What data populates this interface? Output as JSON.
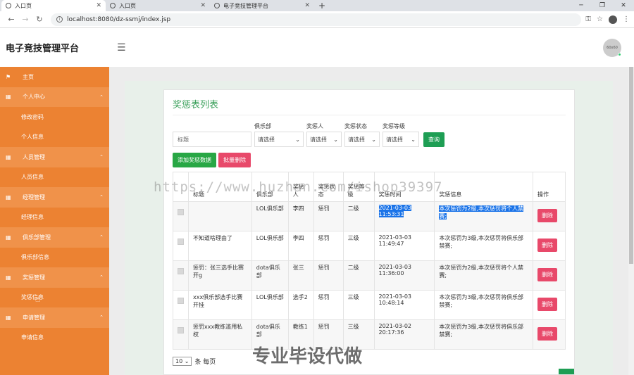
{
  "browser": {
    "tabs": [
      {
        "label": "入口页",
        "active": true
      },
      {
        "label": "入口页",
        "active": false
      },
      {
        "label": "电子竞技管理平台",
        "active": false
      }
    ],
    "url": "localhost:8080/dz-ssmj/index.jsp"
  },
  "app": {
    "title": "电子竞技管理平台",
    "avatar_text": "60x60"
  },
  "sidebar": {
    "home": "主页",
    "groups": [
      {
        "label": "个人中心",
        "items": [
          "修改密码",
          "个人信息"
        ]
      },
      {
        "label": "人员管理",
        "items": [
          "人员信息"
        ]
      },
      {
        "label": "经理管理",
        "items": [
          "经理信息"
        ]
      },
      {
        "label": "俱乐部管理",
        "items": [
          "俱乐部信息"
        ]
      },
      {
        "label": "奖惩管理",
        "items": [
          "奖惩信息"
        ]
      },
      {
        "label": "申请管理",
        "items": [
          "申请信息"
        ]
      }
    ]
  },
  "page": {
    "title": "奖惩表列表",
    "filters": {
      "title_placeholder": "标题",
      "club_label": "俱乐部",
      "club_value": "请选择",
      "person_label": "奖惩人",
      "person_value": "请选择",
      "status_label": "奖惩状态",
      "status_value": "请选择",
      "level_label": "奖惩等级",
      "level_value": "请选择",
      "search_button": "查询"
    },
    "add_button": "添加奖惩数据",
    "batch_delete_button": "批量删除",
    "table": {
      "headers": [
        "",
        "标题",
        "俱乐部",
        "奖惩人",
        "奖惩状态",
        "奖惩等级",
        "奖惩时间",
        "奖惩信息",
        "操作"
      ],
      "rows": [
        {
          "title": "",
          "club": "LOL俱乐部",
          "person": "李四",
          "status": "惩罚",
          "level": "二级",
          "time": "2021-03-03 11:53:31",
          "info": "本次惩罚为2级,本次惩罚将个人禁赛;",
          "delete": "删除"
        },
        {
          "title": "不知道啥理由了",
          "club": "LOL俱乐部",
          "person": "李四",
          "status": "惩罚",
          "level": "三级",
          "time": "2021-03-03 11:49:47",
          "info": "本次惩罚为3级,本次惩罚将俱乐部禁赛;",
          "delete": "删除"
        },
        {
          "title": "惩罚：张三选手比赛开g",
          "club": "dota俱乐部",
          "person": "张三",
          "status": "惩罚",
          "level": "二级",
          "time": "2021-03-03 11:36:00",
          "info": "本次惩罚为2级,本次惩罚将个人禁赛;",
          "delete": "删除"
        },
        {
          "title": "xxx俱乐部选手比赛开挂",
          "club": "LOL俱乐部",
          "person": "选手2",
          "status": "惩罚",
          "level": "三级",
          "time": "2021-03-03 10:48:14",
          "info": "本次惩罚为3级,本次惩罚将俱乐部禁赛;",
          "delete": "删除"
        },
        {
          "title": "惩罚xxx教练滥用私权",
          "club": "dota俱乐部",
          "person": "教练1",
          "status": "惩罚",
          "level": "三级",
          "time": "2021-03-02 20:17:36",
          "info": "本次惩罚为3级,本次惩罚将俱乐部禁赛;",
          "delete": "删除"
        }
      ]
    },
    "pager": {
      "page_size": "10",
      "suffix": "条 每页"
    }
  },
  "overlay": {
    "watermark_url": "https://www.huzhan.com/ishop39397",
    "watermark_text": "专业毕设代做"
  },
  "colors": {
    "sidebar": "#ec8232",
    "accent_green": "#28a745",
    "danger": "#e8496a",
    "title_green": "#3aa05a"
  }
}
